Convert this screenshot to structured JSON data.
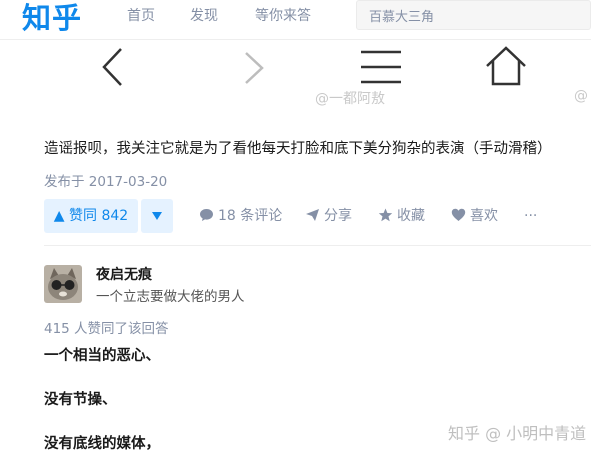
{
  "header": {
    "logo": "知乎",
    "nav": [
      "首页",
      "发现",
      "等你来答"
    ],
    "search_value": "百慕大三角"
  },
  "image_overlay": {
    "weibo_watermark": "@一都阿敖",
    "weibo_watermark_partial": "@"
  },
  "post": {
    "text": "造谣报呗，我关注它就是为了看他每天打脸和底下美分狗杂的表演（手动滑稽）",
    "date": "发布于 2017-03-20",
    "actions": {
      "upvote": "▲ 赞同 842",
      "downvote": "▼",
      "comment": "18 条评论",
      "share": "分享",
      "collect": "收藏",
      "like": "喜欢",
      "more": "···"
    }
  },
  "answer": {
    "author": "夜启无痕",
    "bio": "一个立志要做大佬的男人",
    "votes_note": "415 人赞同了该回答",
    "paragraphs": [
      "一个相当的恶心、",
      "没有节操、",
      "没有底线的媒体，"
    ]
  },
  "watermark": "知乎 @ 小明中青道",
  "colors": {
    "brand": "#0f88eb",
    "muted": "#8590a6",
    "vote_bg": "#e5f2ff"
  }
}
